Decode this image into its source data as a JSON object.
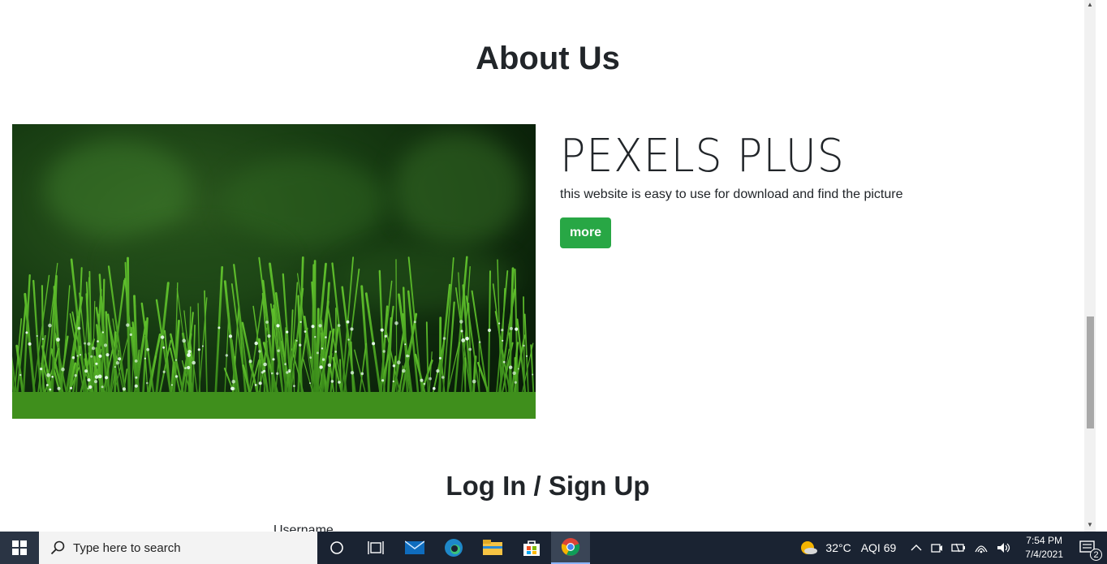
{
  "about": {
    "title": "About Us",
    "brand": "PEXELS PLUS",
    "description": "this website is easy to use for download and find the picture",
    "more_label": "more",
    "image_alt": "dewy green grass"
  },
  "auth": {
    "title": "Log In / Sign Up",
    "username_label": "Username"
  },
  "taskbar": {
    "search_placeholder": "Type here to search",
    "weather": "32°C",
    "aqi": "AQI 69",
    "time": "7:54 PM",
    "date": "7/4/2021",
    "notification_count": "2",
    "pinned_icons": [
      "cortana-icon",
      "task-view-icon",
      "mail-icon",
      "edge-icon",
      "file-explorer-icon",
      "store-icon",
      "chrome-icon"
    ]
  },
  "colors": {
    "accent_button": "#28a745",
    "taskbar": "#1a2332"
  }
}
